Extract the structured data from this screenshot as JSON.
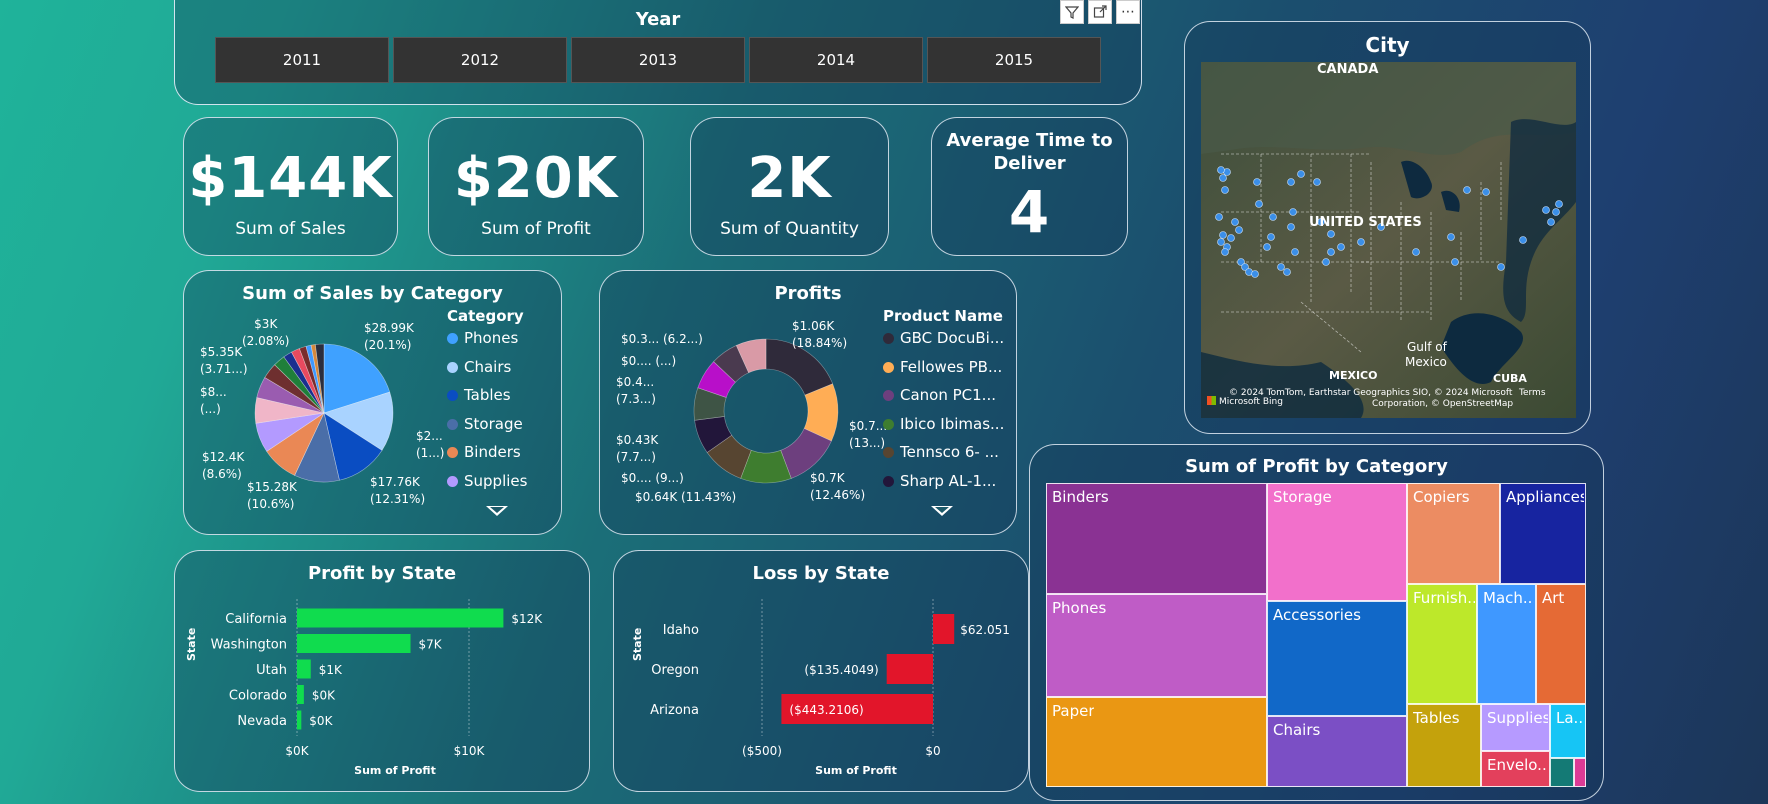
{
  "slicer": {
    "title": "Year",
    "years": [
      "2011",
      "2012",
      "2013",
      "2014",
      "2015"
    ]
  },
  "toolbar": {
    "filter_icon": "filter-icon",
    "focus_icon": "focus-mode-icon",
    "more_icon": "more-options-icon",
    "more_label": "⋯"
  },
  "kpis": {
    "sales": {
      "value": "$144K",
      "label": "Sum of Sales"
    },
    "profit": {
      "value": "$20K",
      "label": "Sum of Profit"
    },
    "quantity": {
      "value": "2K",
      "label": "Sum of Quantity"
    },
    "deliver": {
      "title_line1": "Average Time to",
      "title_line2": "Deliver",
      "value": "4"
    }
  },
  "map": {
    "title": "City",
    "labels": {
      "canada": "CANADA",
      "us": "UNITED STATES",
      "gulf1": "Gulf of",
      "gulf2": "Mexico",
      "mexico": "MEXICO",
      "cuba": "CUBA"
    },
    "copyright1": "© 2024 TomTom, Earthstar Geographics SIO, © 2024 Microsoft",
    "copyright2": "Corporation, © OpenStreetMap",
    "terms": "Terms",
    "bing": "Microsoft Bing"
  },
  "sales_by_category": {
    "title": "Sum of Sales by Category",
    "legend_title": "Category",
    "legend": [
      {
        "name": "Phones",
        "color": "#3fa1ff"
      },
      {
        "name": "Chairs",
        "color": "#a9d3ff"
      },
      {
        "name": "Tables",
        "color": "#0a4dc2"
      },
      {
        "name": "Storage",
        "color": "#4a6ea8"
      },
      {
        "name": "Binders",
        "color": "#ea8855"
      },
      {
        "name": "Supplies",
        "color": "#b39aff"
      }
    ],
    "labels": {
      "phones1": "$28.99K",
      "phones2": "(20.1%)",
      "chairs1": "$2...",
      "chairs2": "(1...)",
      "tables1": "$17.76K",
      "tables2": "(12.31%)",
      "storage1": "$15.28K",
      "storage2": "(10.6%)",
      "binders1": "$12.4K",
      "binders2": "(8.6%)",
      "s8a": "$8...",
      "s8b": "(...)",
      "s535a": "$5.35K",
      "s535b": "(3.71...)",
      "s3a": "$3K",
      "s3b": "(2.08%)"
    }
  },
  "profits": {
    "title": "Profits",
    "legend_title": "Product Name",
    "legend": [
      {
        "name": "GBC DocuBi...",
        "color": "#2f2a3a"
      },
      {
        "name": "Fellowes PB...",
        "color": "#ffad55"
      },
      {
        "name": "Canon PC1...",
        "color": "#6d3f7e"
      },
      {
        "name": "Ibico Ibimas...",
        "color": "#3e7d2f"
      },
      {
        "name": "Tennsco 6- ...",
        "color": "#574531"
      },
      {
        "name": "Sharp AL-1...",
        "color": "#22163a"
      }
    ],
    "labels": {
      "a1": "$1.06K",
      "a2": "(18.84%)",
      "b1": "$0.7...",
      "b2": "(13...)",
      "c1": "$0.7K",
      "c2": "(12.46%)",
      "d1": "$0.64K (11.43%)",
      "e1": "$0....",
      "e2": "(9...)",
      "f1": "$0.43K",
      "f2": "(7.7...)",
      "g1": "$0.4...",
      "g2": "(7.3...)",
      "h1": "$0....",
      "h2": "(...)",
      "i1": "$0.3... (6.2...)"
    }
  },
  "profit_by_state": {
    "title": "Profit by State",
    "y_axis": "State",
    "x_axis": "Sum of Profit",
    "ticks": [
      "$0K",
      "$10K"
    ],
    "states": [
      "California",
      "Washington",
      "Utah",
      "Colorado",
      "Nevada"
    ],
    "values": [
      12,
      6.6,
      0.8,
      0.4,
      0.25
    ],
    "value_labels": [
      "$12K",
      "$7K",
      "$1K",
      "$0K",
      "$0K"
    ],
    "bar_color": "#10dc4e"
  },
  "loss_by_state": {
    "title": "Loss by State",
    "y_axis": "State",
    "x_axis": "Sum of Profit",
    "ticks": [
      "($500)",
      "$0"
    ],
    "states": [
      "Idaho",
      "Oregon",
      "Arizona"
    ],
    "values": [
      62.051,
      -135.4049,
      -443.2106
    ],
    "value_labels": [
      "$62.051",
      "($135.4049)",
      "($443.2106)"
    ],
    "bar_color": "#e2152a"
  },
  "treemap": {
    "title": "Sum of Profit by Category",
    "tiles": [
      {
        "name": "Binders",
        "color": "#8a3293"
      },
      {
        "name": "Phones",
        "color": "#bf5cc6"
      },
      {
        "name": "Paper",
        "color": "#ea9713"
      },
      {
        "name": "Storage",
        "color": "#f270cb"
      },
      {
        "name": "Accessories",
        "color": "#1168c8"
      },
      {
        "name": "Chairs",
        "color": "#7b4fc5"
      },
      {
        "name": "Copiers",
        "color": "#ec8c62"
      },
      {
        "name": "Appliances",
        "color": "#1724a0"
      },
      {
        "name": "Furnish...",
        "color": "#bde82a"
      },
      {
        "name": "Mach...",
        "color": "#3f98ff"
      },
      {
        "name": "Art",
        "color": "#e56a35"
      },
      {
        "name": "Tables",
        "color": "#c4a20c"
      },
      {
        "name": "Supplies",
        "color": "#b69aff"
      },
      {
        "name": "La...",
        "color": "#16c5f5"
      },
      {
        "name": "Envelo...",
        "color": "#e3405c"
      },
      {
        "name": "",
        "color": "#147a75"
      },
      {
        "name": "",
        "color": "#dc3b96"
      }
    ]
  }
}
